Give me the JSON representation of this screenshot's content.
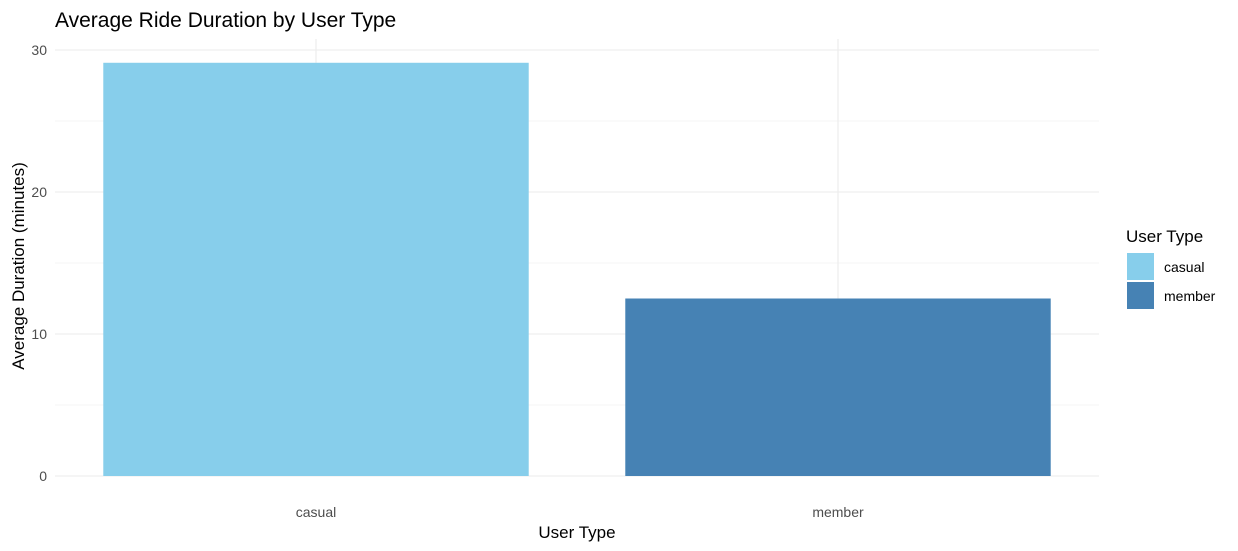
{
  "chart_data": {
    "type": "bar",
    "title": "Average Ride Duration by User Type",
    "xlabel": "User Type",
    "ylabel": "Average Duration (minutes)",
    "categories": [
      "casual",
      "member"
    ],
    "values": [
      29.1,
      12.5
    ],
    "ylim": [
      0,
      30.5
    ],
    "yticks": [
      0,
      10,
      20,
      30
    ],
    "colors": [
      "#87CEEB",
      "#4682B4"
    ],
    "grid": true,
    "legend": {
      "title": "User Type",
      "placement": "right",
      "entries": [
        "casual",
        "member"
      ]
    }
  }
}
